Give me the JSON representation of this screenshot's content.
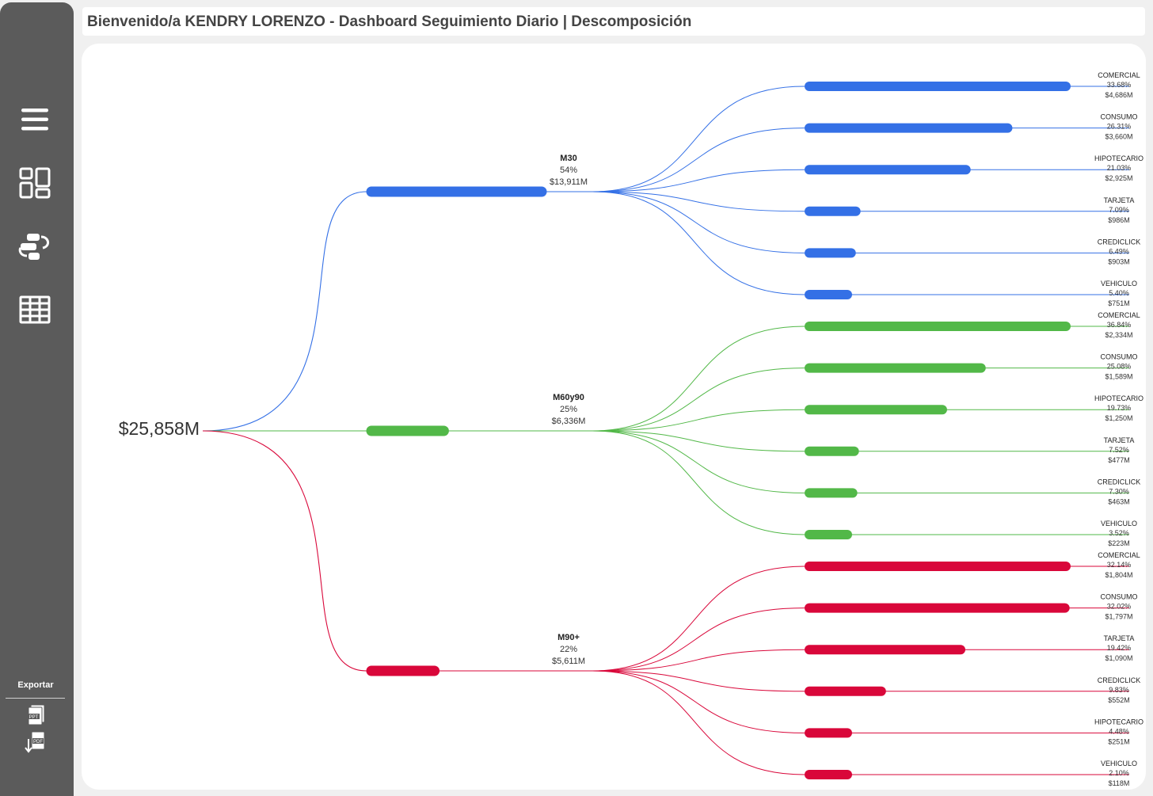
{
  "header": {
    "title": "Bienvenido/a KENDRY LORENZO - Dashboard Seguimiento Diario | Descomposición"
  },
  "sidebar": {
    "icons": [
      "menu-icon",
      "dashboard-layout-icon",
      "flow-switch-icon",
      "table-grid-icon"
    ],
    "export_label": "Exportar",
    "export_icons": [
      "ppt-export-icon",
      "pdf-export-icon"
    ]
  },
  "colors": {
    "M30": "#3470e6",
    "M60y90": "#52b848",
    "M90+": "#d9073a"
  },
  "chart_data": {
    "type": "decomposition-tree",
    "root": {
      "value": 25858,
      "label": "$25,858M"
    },
    "groups": [
      {
        "name": "M30",
        "pct_label": "54%",
        "value_label": "$13,911M",
        "value": 13911,
        "children": [
          {
            "name": "COMERCIAL",
            "pct_label": "33.68%",
            "value_label": "$4,686M",
            "value": 4686
          },
          {
            "name": "CONSUMO",
            "pct_label": "26.31%",
            "value_label": "$3,660M",
            "value": 3660
          },
          {
            "name": "HIPOTECARIO",
            "pct_label": "21.03%",
            "value_label": "$2,925M",
            "value": 2925
          },
          {
            "name": "TARJETA",
            "pct_label": "7.09%",
            "value_label": "$986M",
            "value": 986
          },
          {
            "name": "CREDICLICK",
            "pct_label": "6.49%",
            "value_label": "$903M",
            "value": 903
          },
          {
            "name": "VEHICULO",
            "pct_label": "5.40%",
            "value_label": "$751M",
            "value": 751
          }
        ]
      },
      {
        "name": "M60y90",
        "pct_label": "25%",
        "value_label": "$6,336M",
        "value": 6336,
        "children": [
          {
            "name": "COMERCIAL",
            "pct_label": "36.84%",
            "value_label": "$2,334M",
            "value": 2334
          },
          {
            "name": "CONSUMO",
            "pct_label": "25.08%",
            "value_label": "$1,589M",
            "value": 1589
          },
          {
            "name": "HIPOTECARIO",
            "pct_label": "19.73%",
            "value_label": "$1,250M",
            "value": 1250
          },
          {
            "name": "TARJETA",
            "pct_label": "7.52%",
            "value_label": "$477M",
            "value": 477
          },
          {
            "name": "CREDICLICK",
            "pct_label": "7.30%",
            "value_label": "$463M",
            "value": 463
          },
          {
            "name": "VEHICULO",
            "pct_label": "3.52%",
            "value_label": "$223M",
            "value": 223
          }
        ]
      },
      {
        "name": "M90+",
        "pct_label": "22%",
        "value_label": "$5,611M",
        "value": 5611,
        "children": [
          {
            "name": "COMERCIAL",
            "pct_label": "32.14%",
            "value_label": "$1,804M",
            "value": 1804
          },
          {
            "name": "CONSUMO",
            "pct_label": "32.02%",
            "value_label": "$1,797M",
            "value": 1797
          },
          {
            "name": "TARJETA",
            "pct_label": "19.42%",
            "value_label": "$1,090M",
            "value": 1090
          },
          {
            "name": "CREDICLICK",
            "pct_label": "9.83%",
            "value_label": "$552M",
            "value": 552
          },
          {
            "name": "HIPOTECARIO",
            "pct_label": "4.48%",
            "value_label": "$251M",
            "value": 251
          },
          {
            "name": "VEHICULO",
            "pct_label": "2.10%",
            "value_label": "$118M",
            "value": 118
          }
        ]
      }
    ]
  }
}
